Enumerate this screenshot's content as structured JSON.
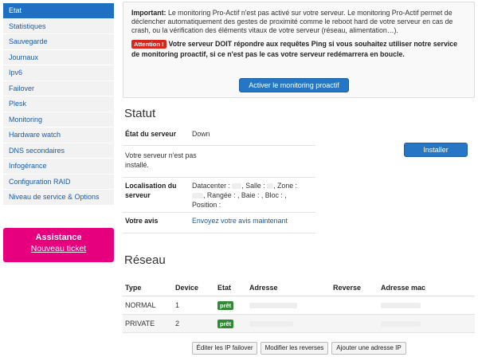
{
  "sidebar": {
    "items": [
      {
        "label": "Etat",
        "active": true
      },
      {
        "label": "Statistiques"
      },
      {
        "label": "Sauvegarde"
      },
      {
        "label": "Journaux"
      },
      {
        "label": "Ipv6"
      },
      {
        "label": "Failover"
      },
      {
        "label": "Plesk"
      },
      {
        "label": "Monitoring"
      },
      {
        "label": "Hardware watch"
      },
      {
        "label": "DNS secondaires"
      },
      {
        "label": "Infogérance"
      },
      {
        "label": "Configuration RAID"
      },
      {
        "label": "Niveau de service & Options"
      }
    ]
  },
  "assistance": {
    "title": "Assistance",
    "link": "Nouveau ticket"
  },
  "alert": {
    "important_label": "Important:",
    "important_text": " Le monitoring Pro-Actif n'est pas activé sur votre serveur. Le monitoring Pro-Actif permet de déclencher automatiquement des gestes de proximité comme le reboot hard de votre serveur en cas de crash, ou la vérification des éléments vitaux de votre serveur (réseau, alimentation…).",
    "attention_badge": "Attention !",
    "warning_text": "Votre serveur DOIT répondre aux requêtes Ping si vous souhaitez utiliser notre service de monitoring proactif, si ce n'est pas le cas votre serveur redémarrera en boucle.",
    "activate_button": "Activer le monitoring proactif"
  },
  "statut": {
    "title": "Statut",
    "etat_label": "État du serveur",
    "etat_value": "Down",
    "not_installed": "Votre serveur n'est pas installé.",
    "loc_label": "Localisation du serveur",
    "loc_datacenter": "Datacenter :",
    "loc_salle": ", Salle :",
    "loc_zone": ", Zone :",
    "loc_rangee": ", Rangée :",
    "loc_baie": ", Baie :",
    "loc_bloc": ", Bloc :",
    "loc_comma": ",",
    "loc_position": "Position :",
    "avis_label": "Votre avis",
    "avis_link": "Envoyez votre avis maintenant",
    "install_button": "Installer"
  },
  "reseau": {
    "title": "Réseau",
    "headers": [
      "Type",
      "Device",
      "Etat",
      "Adresse",
      "Reverse",
      "Adresse mac"
    ],
    "rows": [
      {
        "type": "NORMAL",
        "device": "1",
        "etat": "prêt"
      },
      {
        "type": "PRIVATE",
        "device": "2",
        "etat": "prêt"
      }
    ],
    "buttons": {
      "edit_failover": "Éditer les IP failover",
      "edit_reverses": "Modifier les reverses",
      "add_ip": "Ajouter une adresse IP"
    }
  },
  "colors": {
    "accent": "#1f6fc3",
    "assistance": "#e6007e",
    "danger": "#d9261c",
    "success": "#2e8b32"
  }
}
